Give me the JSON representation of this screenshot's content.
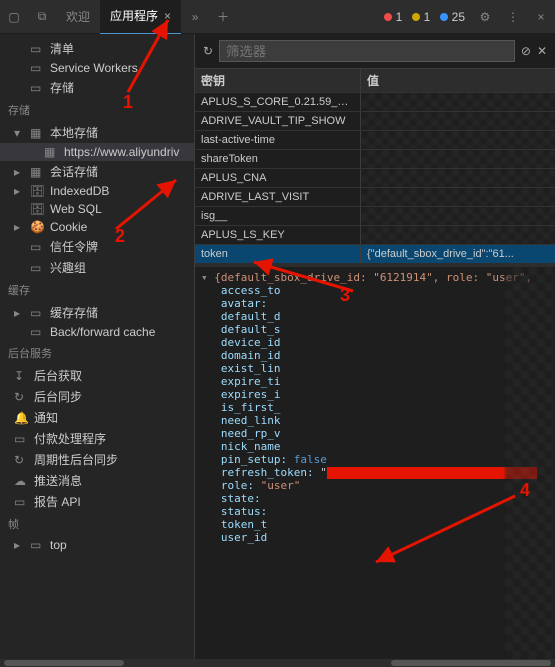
{
  "tabbar": {
    "welcome": "欢迎",
    "application": "应用程序"
  },
  "badges": {
    "errors": "1",
    "warnings": "1",
    "info": "25"
  },
  "toolbar": {
    "filter_placeholder": "筛选器"
  },
  "sidebar": {
    "sec0_items": [
      "清单",
      "Service Workers",
      "存储"
    ],
    "storage_hdr": "存储",
    "local_storage": "本地存储",
    "local_storage_url": "https://www.aliyundriv",
    "session_storage": "会话存储",
    "indexeddb": "IndexedDB",
    "websql": "Web SQL",
    "cookie": "Cookie",
    "trust_tokens": "信任令牌",
    "interest_groups": "兴趣组",
    "cache_hdr": "缓存",
    "cache_storage": "缓存存储",
    "bf_cache": "Back/forward cache",
    "bg_hdr": "后台服务",
    "bg_fetch": "后台获取",
    "bg_sync": "后台同步",
    "notif": "通知",
    "pay": "付款处理程序",
    "periodic": "周期性后台同步",
    "push": "推送消息",
    "report": "报告 API",
    "frames_hdr": "帧",
    "top": "top"
  },
  "table": {
    "head_key": "密钥",
    "head_val": "值",
    "rows": [
      "APLUS_S_CORE_0.21.59_202...",
      "ADRIVE_VAULT_TIP_SHOW",
      "last-active-time",
      "shareToken",
      "APLUS_CNA",
      "ADRIVE_LAST_VISIT",
      "isg__",
      "APLUS_LS_KEY",
      "token"
    ],
    "token_val_preview": "{\"default_sbox_drive_id\":\"61..."
  },
  "detail": {
    "header": "{default_sbox_drive_id: \"6121914\", role: \"user\",",
    "keys": [
      "access_to",
      "avatar: ",
      "default_d",
      "default_s",
      "device_id",
      "domain_id",
      "exist_lin",
      "expire_ti",
      "expires_i",
      "is_first_",
      "need_link",
      "need_rp_v",
      "nick_name"
    ],
    "pin_setup_key": "pin_setup:",
    "pin_setup_val": "false",
    "refresh_key": "refresh_token:",
    "role_key": "role:",
    "role_val": "\"user\"",
    "tail_keys": [
      "state:",
      "status:",
      "token_t",
      "user_id"
    ]
  },
  "annotations": {
    "n1": "1",
    "n2": "2",
    "n3": "3",
    "n4": "4"
  }
}
